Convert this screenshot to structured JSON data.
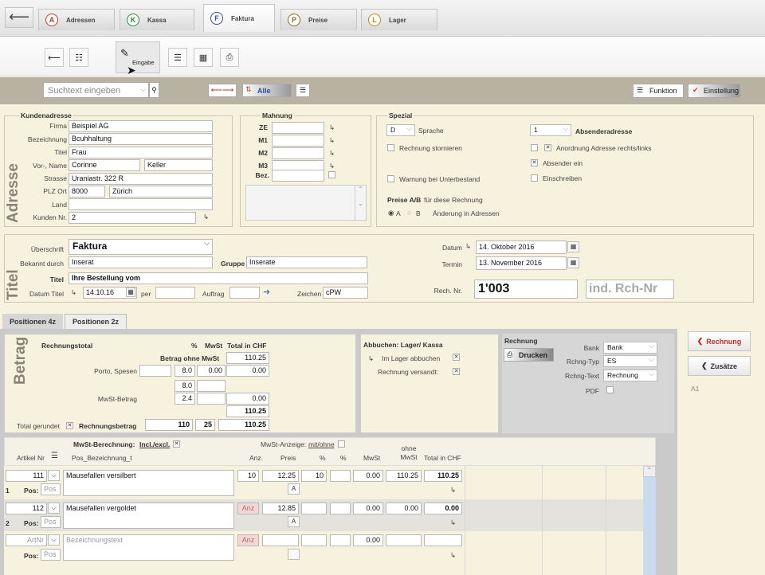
{
  "nav": {
    "tabs": [
      {
        "letter": "A",
        "label": "Adressen",
        "color": "#c0392b"
      },
      {
        "letter": "K",
        "label": "Kassa",
        "color": "#2e8b3a"
      },
      {
        "letter": "F",
        "label": "Faktura",
        "color": "#2c4fa0"
      },
      {
        "letter": "P",
        "label": "Preise",
        "color": "#8a6d1a"
      },
      {
        "letter": "L",
        "label": "Lager",
        "color": "#b98a16"
      }
    ]
  },
  "toolbar": {
    "eingabe": "Eingabe"
  },
  "search": {
    "placeholder": "Suchtext eingeben",
    "filter": "Alle",
    "funktion": "Funktion",
    "einstellung": "Einstellung"
  },
  "kunden": {
    "title": "Kundenadresse",
    "vtitle": "Adresse",
    "labels": {
      "firma": "Firma",
      "bez": "Bezeichnung",
      "titel": "Titel",
      "vorname": "Vor-, Name",
      "strasse": "Strasse",
      "plzort": "PLZ  Ort",
      "land": "Land",
      "kundennr": "Kunden Nr."
    },
    "firma": "Beispiel AG",
    "bez": "Bcuhhaltung",
    "titel": "Frau",
    "vorname": "Corinne",
    "name": "Keller",
    "strasse": "Uraniastr. 322 R",
    "plz": "8000",
    "ort": "Zürich",
    "land": "",
    "kundennr": "2"
  },
  "mahnung": {
    "title": "Mahnung",
    "labels": [
      "ZE",
      "M1",
      "M2",
      "M3"
    ],
    "bez": "Bez."
  },
  "spezial": {
    "title": "Spezial",
    "sprache_val": "D",
    "sprache": "Sprache",
    "absender_val": "1",
    "absender": "Absenderadresse",
    "storno": "Rechnung stornieren",
    "anordnung": "Anordnung Adresse rechts/links",
    "absender_ein": "Absender ein",
    "warnung": "Warnung bei Unterbestand",
    "einschreiben": "Einschreiben",
    "preise": "Preise A/B",
    "preise_sub": "für diese Rechnung",
    "a": "A",
    "b": "B",
    "aend": "Änderung in Adressen"
  },
  "titel": {
    "vtitle": "Titel",
    "ueberschrift_l": "Überschrift",
    "ueberschrift": "Faktura",
    "bekannt_l": "Bekannt durch",
    "bekannt": "Inserat",
    "gruppe_l": "Gruppe",
    "gruppe": "Inserate",
    "titel_l": "Titel",
    "titel": "Ihre Bestellung vom",
    "datumtitel_l": "Datum Titel",
    "datumtitel": "14.10.16",
    "per": "per",
    "auftrag": "Auftrag",
    "zeichen_l": "Zeichen",
    "zeichen": "cPW",
    "datum_l": "Datum",
    "datum": "14. Oktober 2016",
    "termin_l": "Termin",
    "termin": "13. November 2016",
    "rechnr_l": "Rech. Nr.",
    "rechnr": "1'003",
    "indnr": "ind. Rch-Nr"
  },
  "tabs": [
    "Positionen 4z",
    "Positionen 2z"
  ],
  "betrag": {
    "vtitle": "Betrag",
    "rechnungstotal": "Rechnungstotal",
    "pct": "%",
    "mwst": "MwSt",
    "total": "Total in CHF",
    "ohne": "Betrag ohne MwSt",
    "v1": "110.25",
    "porto": "Porto, Spesen",
    "porto_pct": "8.0",
    "porto_mwst": "0.00",
    "porto_total": "0.00",
    "r2pct": "8.0",
    "mwst_l": "MwSt-Betrag",
    "mwst_pct": "2.4",
    "mwst_total": "0.00",
    "sum": "110.25",
    "gerundet": "Total gerundet",
    "rb": "Rechnungsbetrag",
    "rb1": "110",
    "rb2": "25",
    "rb3": "110.25"
  },
  "abbuchen": {
    "title": "Abbuchen: Lager/ Kassa",
    "lager": "Im Lager abbuchen",
    "versandt": "Rechnung versandt:"
  },
  "rechnung": {
    "title": "Rechnung",
    "drucken": "Drucken",
    "bank_l": "Bank",
    "bank": "Bank",
    "typ_l": "Rchng-Typ",
    "typ": "ES",
    "text_l": "Rchng-Text",
    "text": "Rechnung",
    "pdf": "PDF"
  },
  "side": {
    "rechnung": "Rechnung",
    "zusaetze": "Zusätze",
    "a1": "A1"
  },
  "table": {
    "mwstberech": "MwSt-Berechnung:",
    "incl": "Incl./excl.",
    "anzeige": "MwSt-Anzeige:",
    "mitohne": "mit/ohne",
    "cols": [
      "Artikel Nr",
      "Pos_Bezeichnung_t",
      "Anz.",
      "Preis",
      "%",
      "%",
      "MwSt",
      "ohne MwSt",
      "Total in CHF"
    ],
    "rows": [
      {
        "nr": "111",
        "bez": "Mausefallen versilbert",
        "anz": "10",
        "preis": "12.25",
        "p1": "10",
        "p2": "",
        "mwst": "0.00",
        "ohne": "110.25",
        "total": "110.25",
        "pos": "1"
      },
      {
        "nr": "112",
        "bez": "Mausefallen vergoldet",
        "anz": "Anz",
        "preis": "12.85",
        "p1": "",
        "p2": "",
        "mwst": "0.00",
        "ohne": "0.00",
        "total": "0.00",
        "pos": "2"
      },
      {
        "nr": "ArtNr",
        "bez": "Bezeichnungstext",
        "anz": "Anz",
        "preis": "",
        "p1": "",
        "p2": "",
        "mwst": "0.00",
        "ohne": "",
        "total": "",
        "pos": ""
      }
    ],
    "pos_l": "Pos:",
    "pos_ph": "Pos",
    "a": "A"
  }
}
